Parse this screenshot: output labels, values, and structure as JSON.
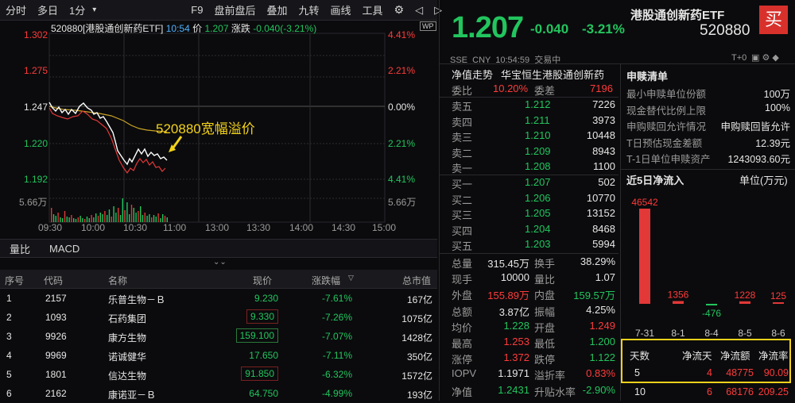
{
  "toolbar": {
    "items": [
      "分时",
      "多日",
      "1分",
      "▾",
      "F9",
      "盘前盘后",
      "叠加",
      "九转",
      "画线",
      "工具"
    ]
  },
  "chart": {
    "title": "520880[港股通创新药ETF]",
    "time": "10:54",
    "price_label": "价",
    "price": "1.207",
    "change_label": "涨跌",
    "change": "-0.040(-3.21%)",
    "wp": "WP",
    "annotation": "520880宽幅溢价",
    "y_left": [
      "1.302",
      "1.275",
      "1.247",
      "1.220",
      "1.192",
      "5.66万"
    ],
    "y_right": [
      "4.41%",
      "2.21%",
      "0.00%",
      "2.21%",
      "4.41%",
      "5.66万"
    ],
    "x_ticks": [
      "09:30",
      "10:00",
      "10:30",
      "11:00",
      "13:00",
      "13:30",
      "14:00",
      "14:30",
      "15:00"
    ]
  },
  "subtabs": [
    "量比",
    "MACD"
  ],
  "table": {
    "headers": [
      "序号",
      "代码",
      "名称",
      "现价",
      "涨跌幅",
      "总市值"
    ],
    "rows": [
      {
        "no": "1",
        "code": "2157",
        "name": "乐普生物－Ｂ",
        "price": "9.230",
        "chg": "-7.61%",
        "cap": "167亿"
      },
      {
        "no": "2",
        "code": "1093",
        "name": "石药集团",
        "price": "9.330",
        "chg": "-7.26%",
        "cap": "1075亿"
      },
      {
        "no": "3",
        "code": "9926",
        "name": "康方生物",
        "price": "159.100",
        "chg": "-7.07%",
        "cap": "1428亿"
      },
      {
        "no": "4",
        "code": "9969",
        "name": "诺诚健华",
        "price": "17.650",
        "chg": "-7.11%",
        "cap": "350亿"
      },
      {
        "no": "5",
        "code": "1801",
        "name": "信达生物",
        "price": "91.850",
        "chg": "-6.32%",
        "cap": "1572亿"
      },
      {
        "no": "6",
        "code": "2162",
        "name": "康诺亚－Ｂ",
        "price": "64.750",
        "chg": "-4.99%",
        "cap": "193亿"
      }
    ]
  },
  "quote": {
    "price": "1.207",
    "change": "-0.040",
    "pct": "-3.21%",
    "name": "港股通创新药ETF",
    "code": "520880",
    "buy": "买",
    "meta": "SSE  CNY  10:54:59  交易中",
    "tplus": "T+0"
  },
  "orderbook": {
    "nav_label": "净值走势",
    "fund": "华宝恒生港股通创新药",
    "wb_label": "委比",
    "wb": "10.20%",
    "wc_label": "委差",
    "wc": "7196",
    "asks": [
      [
        "卖五",
        "1.212",
        "7226"
      ],
      [
        "卖四",
        "1.211",
        "3973"
      ],
      [
        "卖三",
        "1.210",
        "10448"
      ],
      [
        "卖二",
        "1.209",
        "8943"
      ],
      [
        "卖一",
        "1.208",
        "1100"
      ]
    ],
    "bids": [
      [
        "买一",
        "1.207",
        "502"
      ],
      [
        "买二",
        "1.206",
        "10770"
      ],
      [
        "买三",
        "1.205",
        "13152"
      ],
      [
        "买四",
        "1.204",
        "8468"
      ],
      [
        "买五",
        "1.203",
        "5994"
      ]
    ]
  },
  "stats": [
    [
      "总量",
      "315.45万",
      "换手",
      "38.29%"
    ],
    [
      "现手",
      "10000",
      "量比",
      "1.07"
    ],
    [
      "外盘",
      "155.89万",
      "内盘",
      "159.57万"
    ],
    [
      "总额",
      "3.87亿",
      "振幅",
      "4.25%"
    ],
    [
      "均价",
      "1.228",
      "开盘",
      "1.249"
    ],
    [
      "最高",
      "1.253",
      "最低",
      "1.200"
    ],
    [
      "涨停",
      "1.372",
      "跌停",
      "1.122"
    ],
    [
      "IOPV",
      "1.1971",
      "溢折率",
      "0.83%"
    ],
    [
      "净值",
      "1.2431",
      "升贴水率",
      "-2.90%"
    ]
  ],
  "subscription": {
    "title": "申赎清单",
    "rows": [
      [
        "最小申赎单位份额",
        "100万"
      ],
      [
        "现金替代比例上限",
        "100%"
      ],
      [
        "申购赎回允许情况",
        "申购赎回皆允许"
      ],
      [
        "T日预估现金差额",
        "12.39元"
      ],
      [
        "T-1日单位申赎资产",
        "1243093.60元"
      ]
    ],
    "flow_title": "近5日净流入",
    "unit": "单位(万元)",
    "flow_days": [
      "7-31",
      "8-1",
      "8-4",
      "8-5",
      "8-6"
    ],
    "flow_values": [
      46542,
      1356,
      -476,
      1228,
      125
    ],
    "flow_labels": [
      "46542",
      "1356",
      "-476",
      "1228",
      "125"
    ],
    "sum_headers": [
      "天数",
      "净流天",
      "净流额",
      "净流率"
    ],
    "sum_rows": [
      [
        "5",
        "4",
        "48775",
        "90.09"
      ],
      [
        "10",
        "6",
        "68176",
        "209.25"
      ]
    ]
  }
}
